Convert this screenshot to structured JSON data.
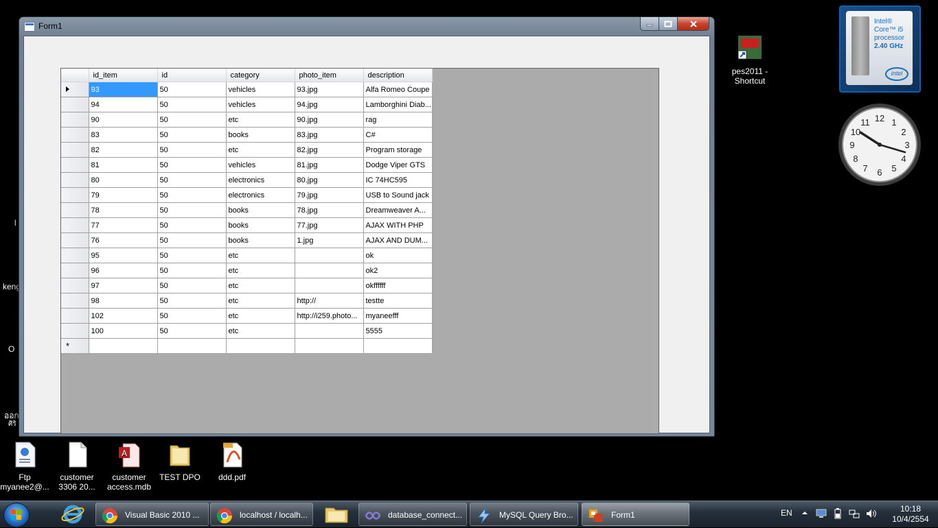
{
  "window": {
    "title": "Form1"
  },
  "grid": {
    "columns": [
      "id_item",
      "id",
      "category",
      "photo_item",
      "description"
    ],
    "rows": [
      [
        "93",
        "50",
        "vehicles",
        "93.jpg",
        "Alfa Romeo Coupe"
      ],
      [
        "94",
        "50",
        "vehicles",
        "94.jpg",
        "Lamborghini Diab..."
      ],
      [
        "90",
        "50",
        "etc",
        "90.jpg",
        "rag"
      ],
      [
        "83",
        "50",
        "books",
        "83.jpg",
        "C#"
      ],
      [
        "82",
        "50",
        "etc",
        "82.jpg",
        "Program storage"
      ],
      [
        "81",
        "50",
        "vehicles",
        "81.jpg",
        "Dodge Viper GTS"
      ],
      [
        "80",
        "50",
        "electronics",
        "80.jpg",
        "IC 74HC595"
      ],
      [
        "79",
        "50",
        "electronics",
        "79.jpg",
        "USB to Sound jack"
      ],
      [
        "78",
        "50",
        "books",
        "78.jpg",
        "Dreamweaver A..."
      ],
      [
        "77",
        "50",
        "books",
        "77.jpg",
        "AJAX WITH PHP"
      ],
      [
        "76",
        "50",
        "books",
        "1.jpg",
        "AJAX AND DUM..."
      ],
      [
        "95",
        "50",
        "etc",
        "",
        "ok"
      ],
      [
        "96",
        "50",
        "etc",
        "",
        "ok2"
      ],
      [
        "97",
        "50",
        "etc",
        "",
        "okffffff"
      ],
      [
        "98",
        "50",
        "etc",
        "http://",
        "testte"
      ],
      [
        "102",
        "50",
        "etc",
        "http://i259.photo...",
        "myaneefff"
      ],
      [
        "100",
        "50",
        "etc",
        "",
        "5555"
      ]
    ],
    "new_row_marker": "*"
  },
  "desktop": {
    "icons": [
      {
        "label": "Ftp myanee2@...",
        "icon": "text-document-icon"
      },
      {
        "label": "customer 3306 20...",
        "icon": "blank-file-icon"
      },
      {
        "label": "customer access.mdb",
        "icon": "access-database-icon"
      },
      {
        "label": "TEST DPO",
        "icon": "folder-icon"
      },
      {
        "label": "ddd.pdf",
        "icon": "pdf-file-icon"
      },
      {
        "label": "pes2011 - Shortcut",
        "icon": "game-shortcut-icon"
      }
    ],
    "partial_labels": [
      "keng",
      "O",
      "ออก",
      "ศิริ",
      "l"
    ]
  },
  "gadgets": {
    "cpu": {
      "line1": "Intel®",
      "line2": "Core™ i5",
      "line3": "processor",
      "speed": "2.40 GHz",
      "brand": "intel"
    },
    "clock": {
      "hour_numbers": [
        "12",
        "1",
        "2",
        "3",
        "4",
        "5",
        "6",
        "7",
        "8",
        "9",
        "10",
        "11"
      ]
    }
  },
  "taskbar": {
    "buttons": [
      {
        "label": "Visual Basic 2010 ...",
        "icon": "chrome-icon"
      },
      {
        "label": "localhost / localh...",
        "icon": "chrome-icon"
      },
      {
        "label": "database_connect...",
        "icon": "visual-studio-icon"
      },
      {
        "label": "MySQL Query Bro...",
        "icon": "mysql-icon"
      },
      {
        "label": "Form1",
        "icon": "form-icon"
      }
    ],
    "language": "EN",
    "time": "10:18",
    "date": "10/4/2554"
  },
  "colors": {
    "selection": "#3399ff",
    "grid_background": "#ababab",
    "taskbar": "#1b232d"
  }
}
